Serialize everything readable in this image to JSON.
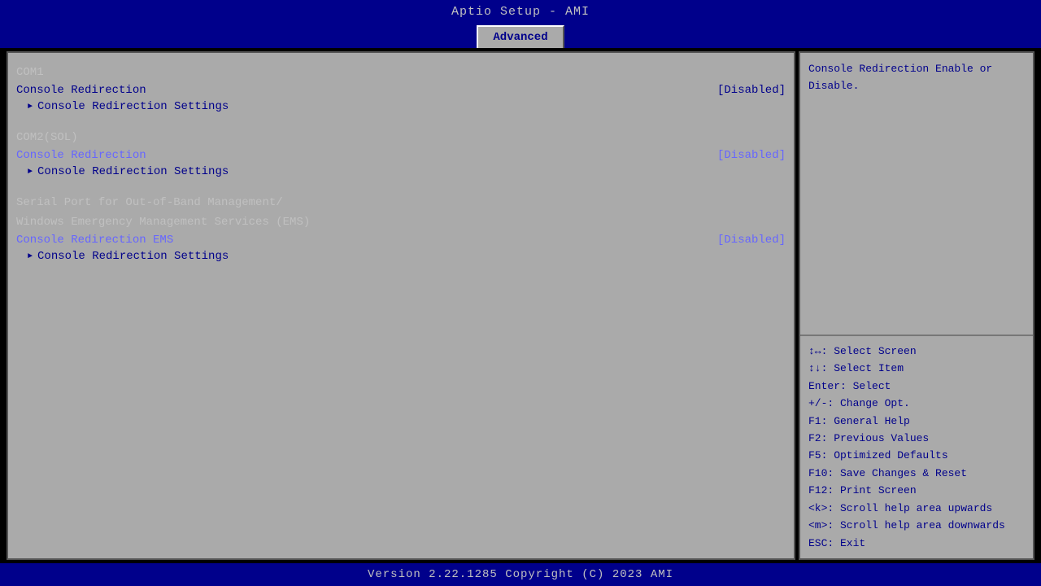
{
  "title": "Aptio Setup - AMI",
  "menu_tabs": [
    {
      "label": "Advanced",
      "active": true
    }
  ],
  "left_panel": {
    "sections": [
      {
        "id": "com1",
        "header": "COM1",
        "rows": [
          {
            "id": "com1-redirect",
            "label": "Console Redirection",
            "value": "[Disabled]",
            "highlight": false,
            "submenu": false,
            "arrow": false
          },
          {
            "id": "com1-settings",
            "label": "Console Redirection Settings",
            "value": "",
            "highlight": false,
            "submenu": true,
            "arrow": true
          }
        ]
      },
      {
        "id": "com2",
        "header": "COM2(SOL)",
        "rows": [
          {
            "id": "com2-redirect",
            "label": "Console Redirection",
            "value": "[Disabled]",
            "highlight": true,
            "submenu": false,
            "arrow": false
          },
          {
            "id": "com2-settings",
            "label": "Console Redirection Settings",
            "value": "",
            "highlight": false,
            "submenu": true,
            "arrow": true
          }
        ]
      },
      {
        "id": "ems",
        "header_line1": "Serial Port for Out-of-Band Management/",
        "header_line2": "Windows Emergency Management Services (EMS)",
        "rows": [
          {
            "id": "ems-redirect",
            "label": "Console Redirection EMS",
            "value": "[Disabled]",
            "highlight": true,
            "submenu": false,
            "arrow": false
          },
          {
            "id": "ems-settings",
            "label": "Console Redirection Settings",
            "value": "",
            "highlight": false,
            "submenu": true,
            "arrow": true
          }
        ]
      }
    ]
  },
  "right_panel": {
    "help_text": "Console Redirection Enable or Disable.",
    "keys": [
      {
        "key": "↔:",
        "action": "Select Screen"
      },
      {
        "key": "↕:",
        "action": "Select Item"
      },
      {
        "key": "Enter:",
        "action": "Select"
      },
      {
        "key": "+/-:",
        "action": "Change Opt."
      },
      {
        "key": "F1:",
        "action": "General Help"
      },
      {
        "key": "F2:",
        "action": "Previous Values"
      },
      {
        "key": "F5:",
        "action": "Optimized Defaults"
      },
      {
        "key": "F10:",
        "action": "Save Changes & Reset"
      },
      {
        "key": "F12:",
        "action": "Print Screen"
      },
      {
        "key": "<k>:",
        "action": "Scroll help area upwards"
      },
      {
        "key": "<m>:",
        "action": "Scroll help area downwards"
      },
      {
        "key": "ESC:",
        "action": "Exit"
      }
    ]
  },
  "footer": "Version 2.22.1285 Copyright (C) 2023 AMI"
}
